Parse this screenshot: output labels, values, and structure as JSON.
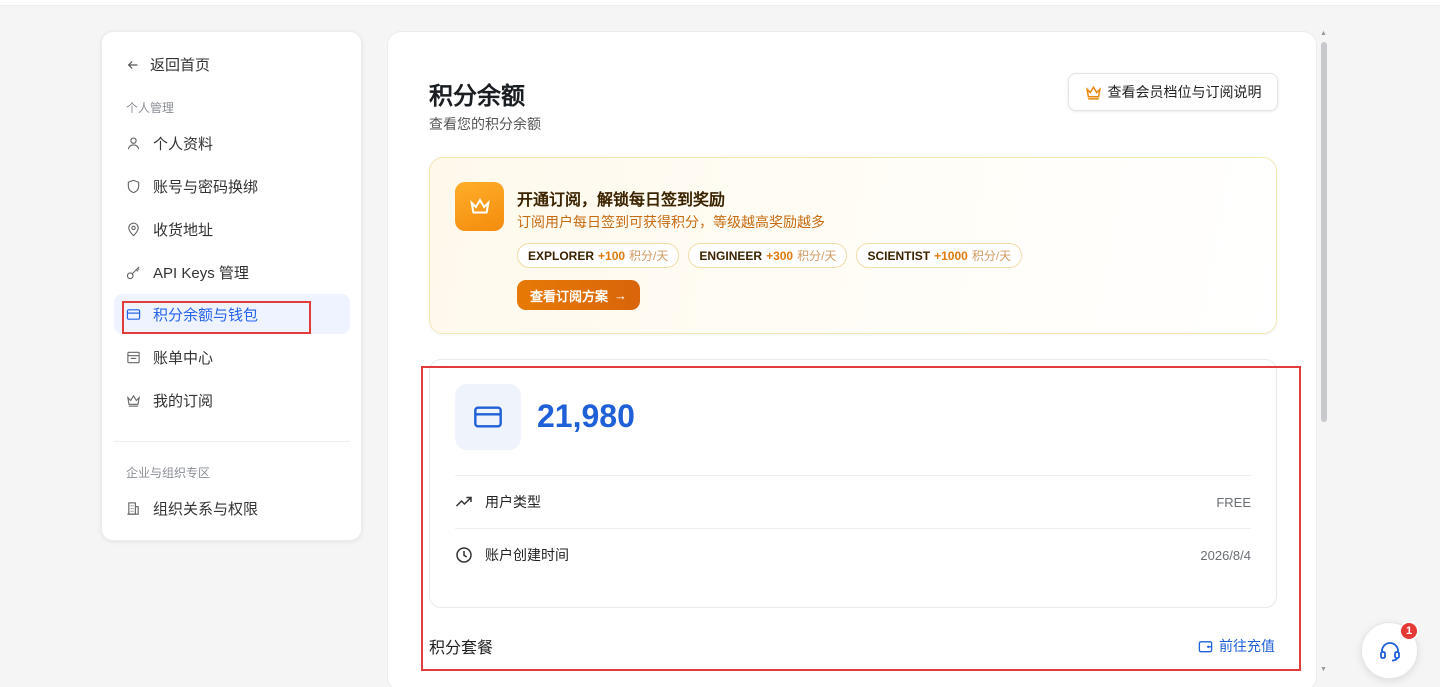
{
  "sidebar": {
    "back_label": "返回首页",
    "group_personal": "个人管理",
    "items": [
      {
        "label": "个人资料"
      },
      {
        "label": "账号与密码换绑"
      },
      {
        "label": "收货地址"
      },
      {
        "label": "API Keys 管理"
      },
      {
        "label": "积分余额与钱包",
        "active": true
      },
      {
        "label": "账单中心"
      },
      {
        "label": "我的订阅"
      }
    ],
    "group_enterprise": "企业与组织专区",
    "enterprise_items": [
      {
        "label": "组织关系与权限"
      }
    ]
  },
  "header": {
    "title": "积分余额",
    "subtitle": "查看您的积分余额",
    "tier_button": "查看会员档位与订阅说明"
  },
  "promo": {
    "title": "开通订阅，解锁每日签到奖励",
    "description": "订阅用户每日签到可获得积分，等级越高奖励越多",
    "chips": [
      {
        "name": "EXPLORER",
        "points": "+100",
        "unit": "积分/天"
      },
      {
        "name": "ENGINEER",
        "points": "+300",
        "unit": "积分/天"
      },
      {
        "name": "SCIENTIST",
        "points": "+1000",
        "unit": "积分/天"
      }
    ],
    "button": "查看订阅方案",
    "button_arrow": "→"
  },
  "balance": {
    "value": "21,980",
    "rows": [
      {
        "label": "用户类型",
        "value": "FREE"
      },
      {
        "label": "账户创建时间",
        "value": "2026/8/4"
      }
    ]
  },
  "packages": {
    "title": "积分套餐",
    "link": "前往充值"
  },
  "support": {
    "badge": "1"
  },
  "colors": {
    "accent": "#1f5fd8",
    "promo_orange": "#f48b0c",
    "highlight_red": "#e23b3b",
    "active_bg": "#eef3ff"
  }
}
